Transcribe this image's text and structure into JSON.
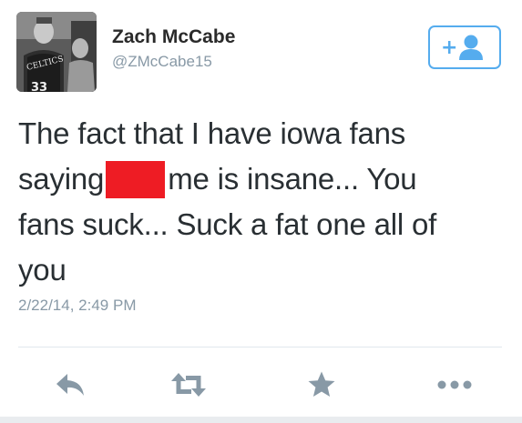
{
  "tweet": {
    "author": {
      "display_name": "Zach McCabe",
      "handle": "@ZMcCabe15",
      "avatar": {
        "icon": "profile-photo",
        "jersey_text": "CELTICS",
        "jersey_number": "33"
      }
    },
    "follow_button": {
      "icon": "follow-person-plus-icon",
      "plus_label": "+"
    },
    "text_lines": [
      {
        "before": "The fact that I have iowa fans",
        "after": ""
      },
      {
        "before": "saying",
        "after": "me is insane... You"
      },
      {
        "before": "fans suck... Suck a fat one all of",
        "after": ""
      },
      {
        "before": "you",
        "after": ""
      }
    ],
    "redaction_color": "#ee1c24",
    "timestamp": "2/22/14, 2:49 PM",
    "actions": [
      {
        "name": "reply",
        "icon": "reply-icon"
      },
      {
        "name": "retweet",
        "icon": "retweet-icon"
      },
      {
        "name": "favorite",
        "icon": "star-icon"
      },
      {
        "name": "more",
        "icon": "more-dots-icon"
      }
    ]
  },
  "colors": {
    "accent": "#55acee",
    "text": "#292f33",
    "muted": "#8899a6",
    "icon": "#8899a6"
  }
}
